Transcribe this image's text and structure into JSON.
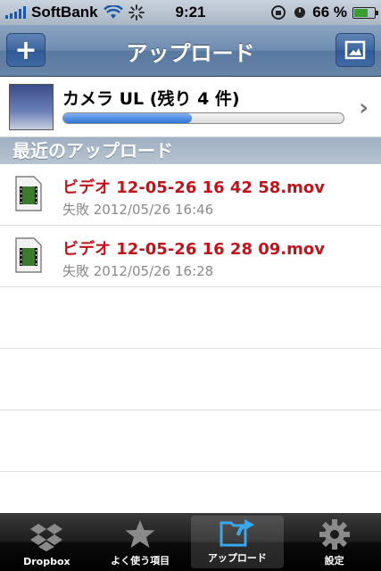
{
  "status_bar": {
    "carrier": "SoftBank",
    "time": "9:21",
    "battery": "66 %",
    "battery_level": 0.66
  },
  "nav": {
    "title": "アップロード",
    "left_button": "+",
    "right_icon": "photo-icon"
  },
  "camera_upload": {
    "label": "カメラ UL (残り 4 件)",
    "progress": 0.46
  },
  "section": {
    "title": "最近のアップロード"
  },
  "uploads": [
    {
      "title": "ビデオ 12-05-26 16 42 58.mov",
      "status": "失敗 2012/05/26 16:46"
    },
    {
      "title": "ビデオ 12-05-26 16 28 09.mov",
      "status": "失敗 2012/05/26 16:28"
    }
  ],
  "tabs": [
    {
      "label": "Dropbox",
      "icon": "dropbox-icon"
    },
    {
      "label": "よく使う項目",
      "icon": "star-icon"
    },
    {
      "label": "アップロード",
      "icon": "upload-icon",
      "active": true
    },
    {
      "label": "設定",
      "icon": "gear-icon"
    }
  ],
  "colors": {
    "failed_title": "#c0141c",
    "accent": "#2f74d8"
  }
}
